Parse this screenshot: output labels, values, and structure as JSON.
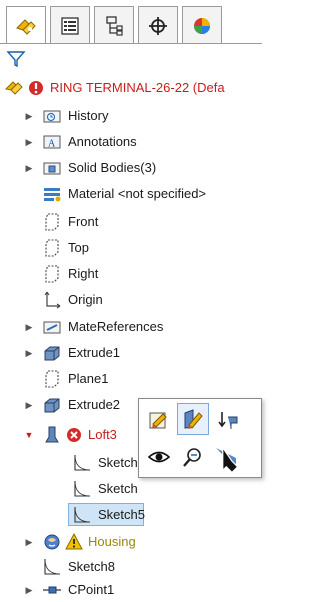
{
  "tabs": [
    {
      "icon": "feature-manager-icon",
      "active": true
    },
    {
      "icon": "property-manager-icon",
      "active": false
    },
    {
      "icon": "configuration-manager-icon",
      "active": false
    },
    {
      "icon": "dimxpert-manager-icon",
      "active": false
    },
    {
      "icon": "display-manager-icon",
      "active": false
    }
  ],
  "filter_icon": "filter-icon",
  "tree": {
    "root": {
      "label": "RING TERMINAL-26-22  (Defa",
      "status": "error"
    },
    "items": [
      {
        "label": "History",
        "icon": "history-folder-icon",
        "expandable": true
      },
      {
        "label": "Annotations",
        "icon": "annotations-icon",
        "expandable": true
      },
      {
        "label": "Solid Bodies(3)",
        "icon": "solid-bodies-folder-icon",
        "expandable": true
      },
      {
        "label": "Material <not specified>",
        "icon": "material-icon",
        "expandable": false
      },
      {
        "label": "Front",
        "icon": "plane-icon",
        "expandable": false
      },
      {
        "label": "Top",
        "icon": "plane-icon",
        "expandable": false
      },
      {
        "label": "Right",
        "icon": "plane-icon",
        "expandable": false
      },
      {
        "label": "Origin",
        "icon": "origin-icon",
        "expandable": false
      },
      {
        "label": "MateReferences",
        "icon": "mate-references-folder-icon",
        "expandable": true
      },
      {
        "label": "Extrude1",
        "icon": "extrude-icon",
        "expandable": true
      },
      {
        "label": "Plane1",
        "icon": "plane-icon",
        "expandable": false
      },
      {
        "label": "Extrude2",
        "icon": "extrude-icon",
        "expandable": true
      },
      {
        "label": "Loft3",
        "icon": "loft-icon",
        "status": "error",
        "expanded": true
      },
      {
        "label": "Sketch",
        "icon": "sketch-icon",
        "expandable": false
      },
      {
        "label": "Sketch",
        "icon": "sketch-icon",
        "expandable": false
      },
      {
        "label": "Sketch5",
        "icon": "sketch-icon",
        "selected": true
      },
      {
        "label": "Housing",
        "icon": "housing-part-icon",
        "status": "warning",
        "expandable": true
      },
      {
        "label": "Sketch8",
        "icon": "sketch-icon",
        "expandable": false
      },
      {
        "label": "CPoint1",
        "icon": "coordinate-point-icon",
        "expandable": true
      }
    ]
  },
  "context_toolbar": {
    "buttons": [
      {
        "icon": "edit-feature-icon"
      },
      {
        "icon": "edit-sketch-icon",
        "highlighted": true
      },
      {
        "icon": "rollback-icon"
      },
      {
        "icon": "show-hide-icon"
      },
      {
        "icon": "zoom-to-selection-icon"
      },
      {
        "icon": "cursor-arrow-icon"
      }
    ]
  }
}
